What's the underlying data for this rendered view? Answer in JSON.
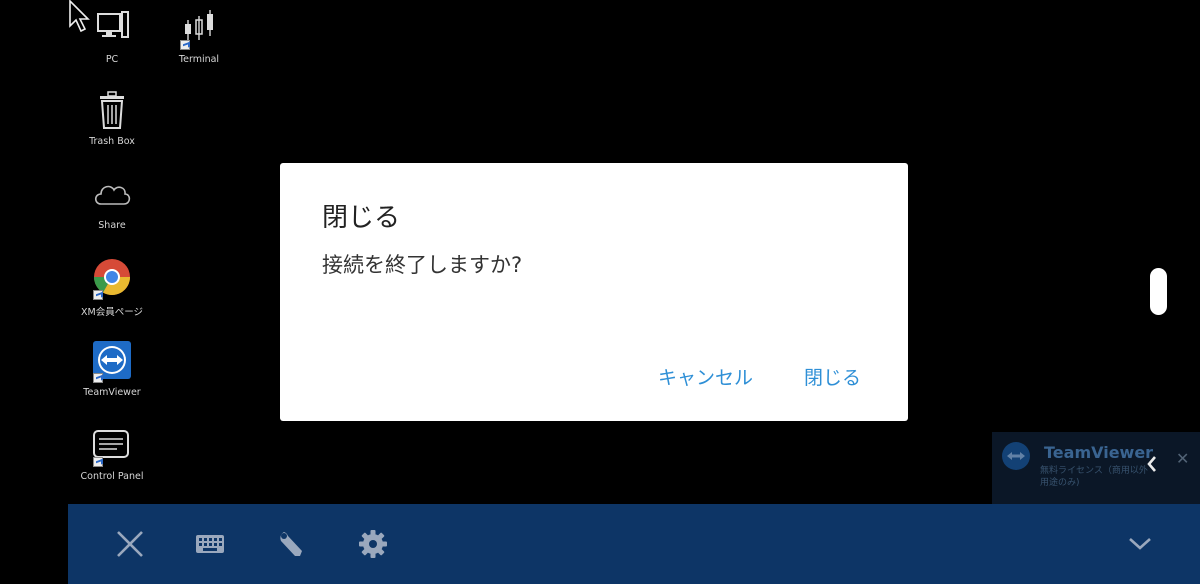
{
  "desktop": {
    "icons": [
      {
        "label": "PC",
        "icon": "monitor-icon"
      },
      {
        "label": "Terminal",
        "icon": "candlestick-chart-icon"
      },
      {
        "label": "Trash Box",
        "icon": "trash-icon"
      },
      {
        "label": "Share",
        "icon": "cloud-icon"
      },
      {
        "label": "XM会員ページ",
        "icon": "chrome-icon"
      },
      {
        "label": "TeamViewer",
        "icon": "teamviewer-icon"
      },
      {
        "label": "Control Panel",
        "icon": "control-panel-icon"
      }
    ]
  },
  "dialog": {
    "title": "閉じる",
    "message": "接続を終了しますか?",
    "cancel_label": "キャンセル",
    "confirm_label": "閉じる"
  },
  "teamviewer_notice": {
    "title": "TeamViewer",
    "line1": "無料ライセンス（商用以外",
    "line2": "用途のみ)"
  },
  "toolbar": {
    "buttons": [
      "close-icon",
      "keyboard-icon",
      "wrench-icon",
      "gear-icon",
      "chevron-down-icon"
    ]
  },
  "colors": {
    "toolbar_bg": "#0d3566",
    "dialog_button": "#2e8fd6",
    "desktop_bg": "#000000"
  }
}
